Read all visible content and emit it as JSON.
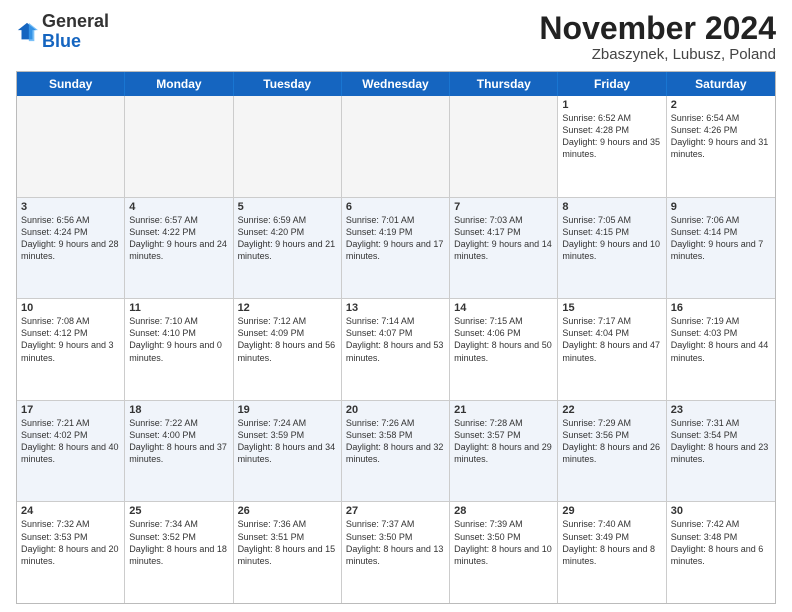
{
  "logo": {
    "general": "General",
    "blue": "Blue"
  },
  "title": "November 2024",
  "location": "Zbaszynek, Lubusz, Poland",
  "days_of_week": [
    "Sunday",
    "Monday",
    "Tuesday",
    "Wednesday",
    "Thursday",
    "Friday",
    "Saturday"
  ],
  "weeks": [
    [
      {
        "day": "",
        "info": ""
      },
      {
        "day": "",
        "info": ""
      },
      {
        "day": "",
        "info": ""
      },
      {
        "day": "",
        "info": ""
      },
      {
        "day": "",
        "info": ""
      },
      {
        "day": "1",
        "info": "Sunrise: 6:52 AM\nSunset: 4:28 PM\nDaylight: 9 hours and 35 minutes."
      },
      {
        "day": "2",
        "info": "Sunrise: 6:54 AM\nSunset: 4:26 PM\nDaylight: 9 hours and 31 minutes."
      }
    ],
    [
      {
        "day": "3",
        "info": "Sunrise: 6:56 AM\nSunset: 4:24 PM\nDaylight: 9 hours and 28 minutes."
      },
      {
        "day": "4",
        "info": "Sunrise: 6:57 AM\nSunset: 4:22 PM\nDaylight: 9 hours and 24 minutes."
      },
      {
        "day": "5",
        "info": "Sunrise: 6:59 AM\nSunset: 4:20 PM\nDaylight: 9 hours and 21 minutes."
      },
      {
        "day": "6",
        "info": "Sunrise: 7:01 AM\nSunset: 4:19 PM\nDaylight: 9 hours and 17 minutes."
      },
      {
        "day": "7",
        "info": "Sunrise: 7:03 AM\nSunset: 4:17 PM\nDaylight: 9 hours and 14 minutes."
      },
      {
        "day": "8",
        "info": "Sunrise: 7:05 AM\nSunset: 4:15 PM\nDaylight: 9 hours and 10 minutes."
      },
      {
        "day": "9",
        "info": "Sunrise: 7:06 AM\nSunset: 4:14 PM\nDaylight: 9 hours and 7 minutes."
      }
    ],
    [
      {
        "day": "10",
        "info": "Sunrise: 7:08 AM\nSunset: 4:12 PM\nDaylight: 9 hours and 3 minutes."
      },
      {
        "day": "11",
        "info": "Sunrise: 7:10 AM\nSunset: 4:10 PM\nDaylight: 9 hours and 0 minutes."
      },
      {
        "day": "12",
        "info": "Sunrise: 7:12 AM\nSunset: 4:09 PM\nDaylight: 8 hours and 56 minutes."
      },
      {
        "day": "13",
        "info": "Sunrise: 7:14 AM\nSunset: 4:07 PM\nDaylight: 8 hours and 53 minutes."
      },
      {
        "day": "14",
        "info": "Sunrise: 7:15 AM\nSunset: 4:06 PM\nDaylight: 8 hours and 50 minutes."
      },
      {
        "day": "15",
        "info": "Sunrise: 7:17 AM\nSunset: 4:04 PM\nDaylight: 8 hours and 47 minutes."
      },
      {
        "day": "16",
        "info": "Sunrise: 7:19 AM\nSunset: 4:03 PM\nDaylight: 8 hours and 44 minutes."
      }
    ],
    [
      {
        "day": "17",
        "info": "Sunrise: 7:21 AM\nSunset: 4:02 PM\nDaylight: 8 hours and 40 minutes."
      },
      {
        "day": "18",
        "info": "Sunrise: 7:22 AM\nSunset: 4:00 PM\nDaylight: 8 hours and 37 minutes."
      },
      {
        "day": "19",
        "info": "Sunrise: 7:24 AM\nSunset: 3:59 PM\nDaylight: 8 hours and 34 minutes."
      },
      {
        "day": "20",
        "info": "Sunrise: 7:26 AM\nSunset: 3:58 PM\nDaylight: 8 hours and 32 minutes."
      },
      {
        "day": "21",
        "info": "Sunrise: 7:28 AM\nSunset: 3:57 PM\nDaylight: 8 hours and 29 minutes."
      },
      {
        "day": "22",
        "info": "Sunrise: 7:29 AM\nSunset: 3:56 PM\nDaylight: 8 hours and 26 minutes."
      },
      {
        "day": "23",
        "info": "Sunrise: 7:31 AM\nSunset: 3:54 PM\nDaylight: 8 hours and 23 minutes."
      }
    ],
    [
      {
        "day": "24",
        "info": "Sunrise: 7:32 AM\nSunset: 3:53 PM\nDaylight: 8 hours and 20 minutes."
      },
      {
        "day": "25",
        "info": "Sunrise: 7:34 AM\nSunset: 3:52 PM\nDaylight: 8 hours and 18 minutes."
      },
      {
        "day": "26",
        "info": "Sunrise: 7:36 AM\nSunset: 3:51 PM\nDaylight: 8 hours and 15 minutes."
      },
      {
        "day": "27",
        "info": "Sunrise: 7:37 AM\nSunset: 3:50 PM\nDaylight: 8 hours and 13 minutes."
      },
      {
        "day": "28",
        "info": "Sunrise: 7:39 AM\nSunset: 3:50 PM\nDaylight: 8 hours and 10 minutes."
      },
      {
        "day": "29",
        "info": "Sunrise: 7:40 AM\nSunset: 3:49 PM\nDaylight: 8 hours and 8 minutes."
      },
      {
        "day": "30",
        "info": "Sunrise: 7:42 AM\nSunset: 3:48 PM\nDaylight: 8 hours and 6 minutes."
      }
    ]
  ]
}
